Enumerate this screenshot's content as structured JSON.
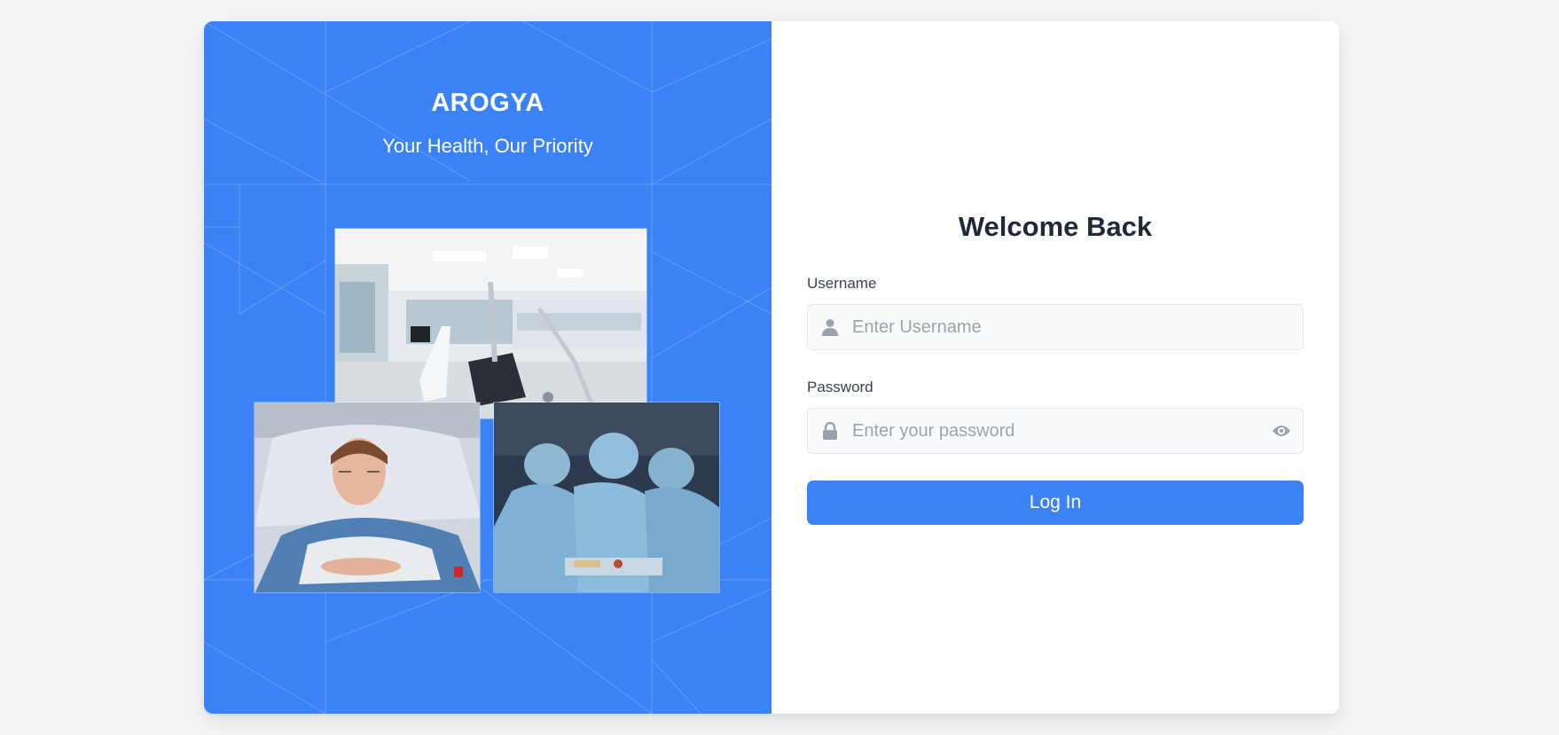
{
  "brand": {
    "name": "AROGYA",
    "tagline": "Your Health, Our Priority"
  },
  "colors": {
    "accent": "#3b82f6",
    "page_bg": "#f3f4f6",
    "heading": "#1f2937",
    "placeholder": "#9ca3af"
  },
  "images": [
    {
      "name": "hospital-room-photo"
    },
    {
      "name": "patient-in-bed-photo"
    },
    {
      "name": "surgery-team-photo"
    }
  ],
  "login": {
    "title": "Welcome Back",
    "username": {
      "label": "Username",
      "placeholder": "Enter Username",
      "value": "",
      "icon": "user-icon"
    },
    "password": {
      "label": "Password",
      "placeholder": "Enter your password",
      "value": "",
      "icon": "lock-icon",
      "toggle_icon": "eye-icon"
    },
    "submit_label": "Log In"
  }
}
